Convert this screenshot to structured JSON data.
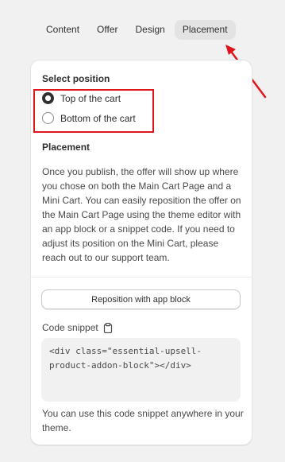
{
  "tabs": [
    {
      "label": "Content"
    },
    {
      "label": "Offer"
    },
    {
      "label": "Design"
    },
    {
      "label": "Placement",
      "active": true
    }
  ],
  "colors": {
    "highlight": "#e0161e",
    "arrow": "#e0161e"
  },
  "select_position": {
    "title": "Select position",
    "options": [
      {
        "label": "Top of the cart",
        "checked": true
      },
      {
        "label": "Bottom of the cart",
        "checked": false
      }
    ]
  },
  "placement": {
    "title": "Placement",
    "description": "Once you publish, the offer will show up where you chose on both the Main Cart Page and a Mini Cart. You can easily reposition the offer on the Main Cart Page using the theme editor with an app block or a snippet code. If you need to adjust its position on the Mini Cart, please reach out to our support team."
  },
  "reposition_button": "Reposition with app block",
  "code_snippet": {
    "label": "Code snippet",
    "icon": "clipboard-icon",
    "code": "<div class=\"essential-upsell-product-addon-block\"></div>",
    "note": "You can use this code snippet anywhere in your theme."
  }
}
